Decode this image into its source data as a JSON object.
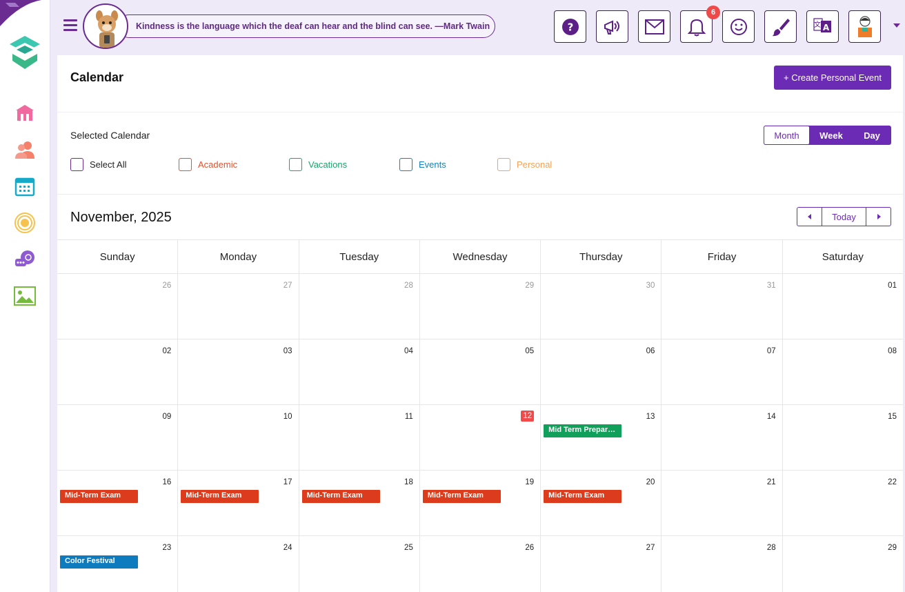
{
  "header": {
    "quote": "Kindness is the language which the deaf can hear and the blind can see. —Mark Twain",
    "notification_count": "6",
    "buttons": [
      "help-icon",
      "announcement-icon",
      "mail-icon",
      "bell-icon",
      "smiley-icon",
      "brush-icon",
      "translate-icon",
      "profile-icon"
    ]
  },
  "sidebar": {
    "items": [
      "home-icon",
      "users-icon",
      "calendar-icon",
      "target-icon",
      "chat-icon",
      "gallery-icon"
    ]
  },
  "page": {
    "title": "Calendar",
    "create_label": "+ Create Personal Event",
    "selected_calendar_label": "Selected Calendar"
  },
  "views": {
    "month": "Month",
    "week": "Week",
    "day": "Day"
  },
  "filters": [
    {
      "label": "Select All",
      "color": "#6a2c91"
    },
    {
      "label": "Academic",
      "color": "#e0532e"
    },
    {
      "label": "Vacations",
      "color": "#1aa36a"
    },
    {
      "label": "Events",
      "color": "#1580b8"
    },
    {
      "label": "Personal",
      "color": "#f2a35a"
    }
  ],
  "calendar": {
    "month_title": "November, 2025",
    "today_label": "Today",
    "weekdays": [
      "Sunday",
      "Monday",
      "Tuesday",
      "Wednesday",
      "Thursday",
      "Friday",
      "Saturday"
    ],
    "weeks": [
      [
        {
          "day": "26",
          "other": true
        },
        {
          "day": "27",
          "other": true
        },
        {
          "day": "28",
          "other": true
        },
        {
          "day": "29",
          "other": true
        },
        {
          "day": "30",
          "other": true
        },
        {
          "day": "31",
          "other": true
        },
        {
          "day": "01"
        }
      ],
      [
        {
          "day": "02"
        },
        {
          "day": "03"
        },
        {
          "day": "04"
        },
        {
          "day": "05"
        },
        {
          "day": "06"
        },
        {
          "day": "07"
        },
        {
          "day": "08"
        }
      ],
      [
        {
          "day": "09"
        },
        {
          "day": "10"
        },
        {
          "day": "11"
        },
        {
          "day": "12",
          "today": true
        },
        {
          "day": "13",
          "event": {
            "label": "Mid Term Prepara...",
            "color": "#11a05a"
          }
        },
        {
          "day": "14"
        },
        {
          "day": "15"
        }
      ],
      [
        {
          "day": "16",
          "event": {
            "label": "Mid-Term Exam",
            "color": "#dd3c1c"
          }
        },
        {
          "day": "17",
          "event": {
            "label": "Mid-Term Exam",
            "color": "#dd3c1c"
          }
        },
        {
          "day": "18",
          "event": {
            "label": "Mid-Term Exam",
            "color": "#dd3c1c"
          }
        },
        {
          "day": "19",
          "event": {
            "label": "Mid-Term Exam",
            "color": "#dd3c1c"
          }
        },
        {
          "day": "20",
          "event": {
            "label": "Mid-Term Exam",
            "color": "#dd3c1c"
          }
        },
        {
          "day": "21"
        },
        {
          "day": "22"
        }
      ],
      [
        {
          "day": "23",
          "event": {
            "label": "Color Festival",
            "color": "#0e7bbf"
          }
        },
        {
          "day": "24"
        },
        {
          "day": "25"
        },
        {
          "day": "26"
        },
        {
          "day": "27"
        },
        {
          "day": "28"
        },
        {
          "day": "29"
        }
      ]
    ]
  },
  "colors": {
    "accent": "#6c2bb5",
    "today": "#f04a4a"
  }
}
